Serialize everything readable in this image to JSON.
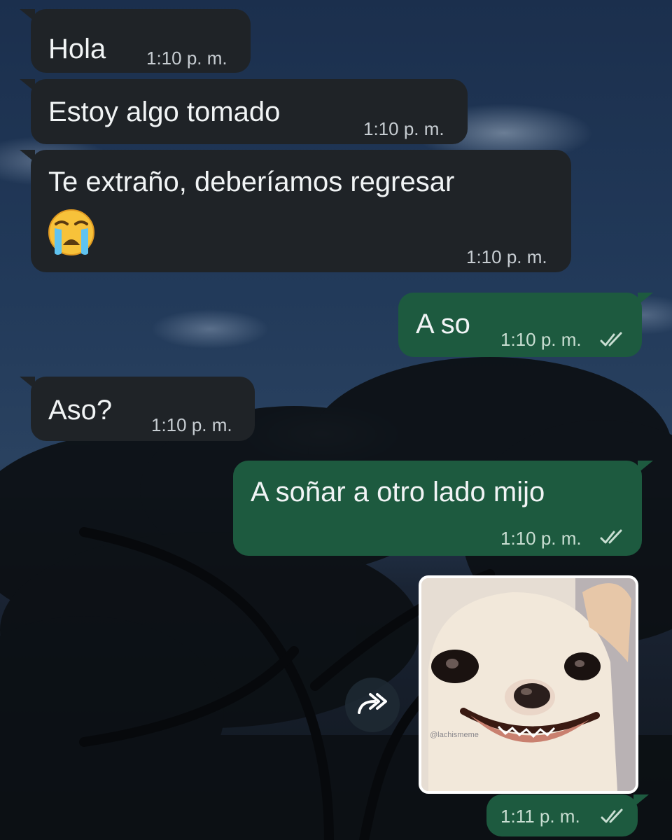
{
  "messages": [
    {
      "direction": "incoming",
      "text": "Hola",
      "time": "1:10 p. m."
    },
    {
      "direction": "incoming",
      "text": "Estoy algo tomado",
      "time": "1:10 p. m."
    },
    {
      "direction": "incoming",
      "text": "Te extraño, deberíamos regresar",
      "emoji": "crying-face",
      "time": "1:10 p. m."
    },
    {
      "direction": "outgoing",
      "text": "A so",
      "time": "1:10 p. m.",
      "status": "read"
    },
    {
      "direction": "incoming",
      "text": "Aso?",
      "time": "1:10 p. m."
    },
    {
      "direction": "outgoing",
      "text": "A soñar a otro lado mijo",
      "time": "1:10 p. m.",
      "status": "read"
    },
    {
      "direction": "outgoing",
      "type": "sticker",
      "sticker": "smiling-chihuahua",
      "watermark": "@lachismeme",
      "time": "1:11 p. m.",
      "status": "read"
    }
  ],
  "icons": {
    "forward": "forward-icon",
    "read_receipt": "double-check-icon"
  },
  "colors": {
    "incoming_bubble": "#1f2327",
    "outgoing_bubble": "#1d5a3f",
    "text": "#f1f4f5",
    "timestamp": "#c7cdd2"
  }
}
